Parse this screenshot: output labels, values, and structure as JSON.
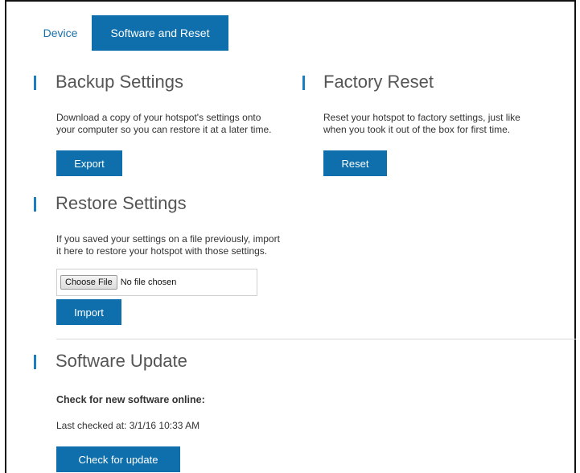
{
  "tabs": {
    "device": "Device",
    "software_reset": "Software and Reset"
  },
  "backup": {
    "title": "Backup Settings",
    "desc_line1": "Download a copy of your hotspot's settings onto",
    "desc_line2": "your computer so you can restore it at a later time.",
    "button": "Export"
  },
  "factory": {
    "title": "Factory Reset",
    "desc_line1": "Reset your hotspot to factory settings, just like",
    "desc_line2": "when you took it out of the box for first time.",
    "button": "Reset"
  },
  "restore": {
    "title": "Restore Settings",
    "desc_line1": "If you saved your settings on a file previously, import",
    "desc_line2": "it here to restore your hotspot with those settings.",
    "choose_file": "Choose File",
    "file_status": "No file chosen",
    "button": "Import"
  },
  "update": {
    "title": "Software Update",
    "check_label": "Check for new software online:",
    "last_checked": "Last checked at: 3/1/16 10:33 AM",
    "button": "Check for update"
  },
  "colors": {
    "accent": "#0f6fac",
    "bar": "#1a7fc1",
    "link": "#1a6fa8"
  }
}
